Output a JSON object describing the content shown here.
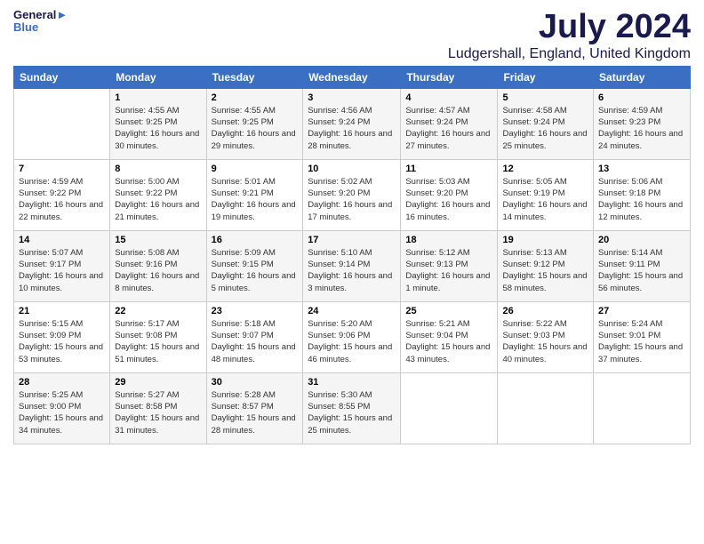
{
  "header": {
    "logo_line1": "General",
    "logo_line2": "Blue",
    "month_year": "July 2024",
    "location": "Ludgershall, England, United Kingdom"
  },
  "weekdays": [
    "Sunday",
    "Monday",
    "Tuesday",
    "Wednesday",
    "Thursday",
    "Friday",
    "Saturday"
  ],
  "weeks": [
    [
      {
        "day": "",
        "sunrise": "",
        "sunset": "",
        "daylight": ""
      },
      {
        "day": "1",
        "sunrise": "Sunrise: 4:55 AM",
        "sunset": "Sunset: 9:25 PM",
        "daylight": "Daylight: 16 hours and 30 minutes."
      },
      {
        "day": "2",
        "sunrise": "Sunrise: 4:55 AM",
        "sunset": "Sunset: 9:25 PM",
        "daylight": "Daylight: 16 hours and 29 minutes."
      },
      {
        "day": "3",
        "sunrise": "Sunrise: 4:56 AM",
        "sunset": "Sunset: 9:24 PM",
        "daylight": "Daylight: 16 hours and 28 minutes."
      },
      {
        "day": "4",
        "sunrise": "Sunrise: 4:57 AM",
        "sunset": "Sunset: 9:24 PM",
        "daylight": "Daylight: 16 hours and 27 minutes."
      },
      {
        "day": "5",
        "sunrise": "Sunrise: 4:58 AM",
        "sunset": "Sunset: 9:24 PM",
        "daylight": "Daylight: 16 hours and 25 minutes."
      },
      {
        "day": "6",
        "sunrise": "Sunrise: 4:59 AM",
        "sunset": "Sunset: 9:23 PM",
        "daylight": "Daylight: 16 hours and 24 minutes."
      }
    ],
    [
      {
        "day": "7",
        "sunrise": "Sunrise: 4:59 AM",
        "sunset": "Sunset: 9:22 PM",
        "daylight": "Daylight: 16 hours and 22 minutes."
      },
      {
        "day": "8",
        "sunrise": "Sunrise: 5:00 AM",
        "sunset": "Sunset: 9:22 PM",
        "daylight": "Daylight: 16 hours and 21 minutes."
      },
      {
        "day": "9",
        "sunrise": "Sunrise: 5:01 AM",
        "sunset": "Sunset: 9:21 PM",
        "daylight": "Daylight: 16 hours and 19 minutes."
      },
      {
        "day": "10",
        "sunrise": "Sunrise: 5:02 AM",
        "sunset": "Sunset: 9:20 PM",
        "daylight": "Daylight: 16 hours and 17 minutes."
      },
      {
        "day": "11",
        "sunrise": "Sunrise: 5:03 AM",
        "sunset": "Sunset: 9:20 PM",
        "daylight": "Daylight: 16 hours and 16 minutes."
      },
      {
        "day": "12",
        "sunrise": "Sunrise: 5:05 AM",
        "sunset": "Sunset: 9:19 PM",
        "daylight": "Daylight: 16 hours and 14 minutes."
      },
      {
        "day": "13",
        "sunrise": "Sunrise: 5:06 AM",
        "sunset": "Sunset: 9:18 PM",
        "daylight": "Daylight: 16 hours and 12 minutes."
      }
    ],
    [
      {
        "day": "14",
        "sunrise": "Sunrise: 5:07 AM",
        "sunset": "Sunset: 9:17 PM",
        "daylight": "Daylight: 16 hours and 10 minutes."
      },
      {
        "day": "15",
        "sunrise": "Sunrise: 5:08 AM",
        "sunset": "Sunset: 9:16 PM",
        "daylight": "Daylight: 16 hours and 8 minutes."
      },
      {
        "day": "16",
        "sunrise": "Sunrise: 5:09 AM",
        "sunset": "Sunset: 9:15 PM",
        "daylight": "Daylight: 16 hours and 5 minutes."
      },
      {
        "day": "17",
        "sunrise": "Sunrise: 5:10 AM",
        "sunset": "Sunset: 9:14 PM",
        "daylight": "Daylight: 16 hours and 3 minutes."
      },
      {
        "day": "18",
        "sunrise": "Sunrise: 5:12 AM",
        "sunset": "Sunset: 9:13 PM",
        "daylight": "Daylight: 16 hours and 1 minute."
      },
      {
        "day": "19",
        "sunrise": "Sunrise: 5:13 AM",
        "sunset": "Sunset: 9:12 PM",
        "daylight": "Daylight: 15 hours and 58 minutes."
      },
      {
        "day": "20",
        "sunrise": "Sunrise: 5:14 AM",
        "sunset": "Sunset: 9:11 PM",
        "daylight": "Daylight: 15 hours and 56 minutes."
      }
    ],
    [
      {
        "day": "21",
        "sunrise": "Sunrise: 5:15 AM",
        "sunset": "Sunset: 9:09 PM",
        "daylight": "Daylight: 15 hours and 53 minutes."
      },
      {
        "day": "22",
        "sunrise": "Sunrise: 5:17 AM",
        "sunset": "Sunset: 9:08 PM",
        "daylight": "Daylight: 15 hours and 51 minutes."
      },
      {
        "day": "23",
        "sunrise": "Sunrise: 5:18 AM",
        "sunset": "Sunset: 9:07 PM",
        "daylight": "Daylight: 15 hours and 48 minutes."
      },
      {
        "day": "24",
        "sunrise": "Sunrise: 5:20 AM",
        "sunset": "Sunset: 9:06 PM",
        "daylight": "Daylight: 15 hours and 46 minutes."
      },
      {
        "day": "25",
        "sunrise": "Sunrise: 5:21 AM",
        "sunset": "Sunset: 9:04 PM",
        "daylight": "Daylight: 15 hours and 43 minutes."
      },
      {
        "day": "26",
        "sunrise": "Sunrise: 5:22 AM",
        "sunset": "Sunset: 9:03 PM",
        "daylight": "Daylight: 15 hours and 40 minutes."
      },
      {
        "day": "27",
        "sunrise": "Sunrise: 5:24 AM",
        "sunset": "Sunset: 9:01 PM",
        "daylight": "Daylight: 15 hours and 37 minutes."
      }
    ],
    [
      {
        "day": "28",
        "sunrise": "Sunrise: 5:25 AM",
        "sunset": "Sunset: 9:00 PM",
        "daylight": "Daylight: 15 hours and 34 minutes."
      },
      {
        "day": "29",
        "sunrise": "Sunrise: 5:27 AM",
        "sunset": "Sunset: 8:58 PM",
        "daylight": "Daylight: 15 hours and 31 minutes."
      },
      {
        "day": "30",
        "sunrise": "Sunrise: 5:28 AM",
        "sunset": "Sunset: 8:57 PM",
        "daylight": "Daylight: 15 hours and 28 minutes."
      },
      {
        "day": "31",
        "sunrise": "Sunrise: 5:30 AM",
        "sunset": "Sunset: 8:55 PM",
        "daylight": "Daylight: 15 hours and 25 minutes."
      },
      {
        "day": "",
        "sunrise": "",
        "sunset": "",
        "daylight": ""
      },
      {
        "day": "",
        "sunrise": "",
        "sunset": "",
        "daylight": ""
      },
      {
        "day": "",
        "sunrise": "",
        "sunset": "",
        "daylight": ""
      }
    ]
  ]
}
